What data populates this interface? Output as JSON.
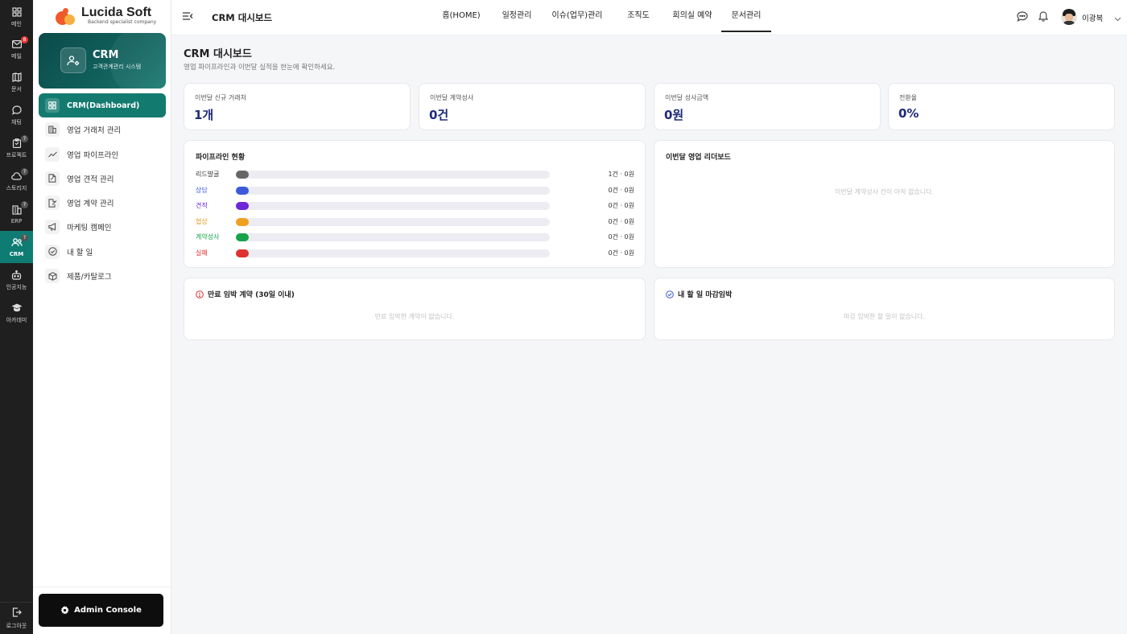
{
  "rail": {
    "items": [
      {
        "label": "메인",
        "icon": "grid-icon",
        "badge": ""
      },
      {
        "label": "메일",
        "icon": "mail-icon",
        "badge": "8"
      },
      {
        "label": "문서",
        "icon": "document-map-icon",
        "badge": ""
      },
      {
        "label": "채팅",
        "icon": "chat-icon",
        "badge": ""
      },
      {
        "label": "프로젝트",
        "icon": "clipboard-icon",
        "badge": "?"
      },
      {
        "label": "스토리지",
        "icon": "cloud-icon",
        "badge": "?"
      },
      {
        "label": "ERP",
        "icon": "building-icon",
        "badge": "?"
      },
      {
        "label": "CRM",
        "icon": "users-icon",
        "badge": "?",
        "active": true
      },
      {
        "label": "인공지능",
        "icon": "robot-icon",
        "badge": ""
      },
      {
        "label": "아카데미",
        "icon": "graduation-cap-icon",
        "badge": ""
      }
    ],
    "logout_label": "로그아웃"
  },
  "sidebar": {
    "logo_title": "Lucida Soft",
    "logo_sub": "Backend specialist company",
    "crm_card": {
      "title": "CRM",
      "subtitle": "고객관계관리 시스템"
    },
    "menu": [
      {
        "label": "CRM(Dashboard)",
        "icon": "dashboard-icon",
        "active": true
      },
      {
        "label": "영업 거래처 관리",
        "icon": "building-icon"
      },
      {
        "label": "영업 파이프라인",
        "icon": "trend-line-icon"
      },
      {
        "label": "영업 견적 관리",
        "icon": "file-edit-icon"
      },
      {
        "label": "영업 계약 관리",
        "icon": "file-sign-icon"
      },
      {
        "label": "마케팅 캠페인",
        "icon": "megaphone-icon"
      },
      {
        "label": "내 할 일",
        "icon": "check-circle-icon"
      },
      {
        "label": "제품/카탈로그",
        "icon": "box-icon"
      }
    ],
    "admin_label": "Admin Console"
  },
  "topbar": {
    "title": "CRM 대시보드",
    "nav": [
      "홈(HOME)",
      "일정관리",
      "이슈(업무)관리",
      "조직도",
      "회의실 예약",
      "문서관리"
    ],
    "active_nav": "문서관리",
    "user_name": "이광복"
  },
  "main": {
    "title": "CRM 대시보드",
    "subtitle": "영업 파이프라인과 이번달 실적을 한눈에 확인하세요.",
    "stats": [
      {
        "label": "이번달 신규 거래처",
        "value": "1개"
      },
      {
        "label": "이번달 계약성사",
        "value": "0건"
      },
      {
        "label": "이번달 성사금액",
        "value": "0원"
      },
      {
        "label": "전환율",
        "value": "0%"
      }
    ],
    "pipeline": {
      "title": "파이프라인 현황",
      "rows": [
        {
          "label": "리드발굴",
          "value": "1건 · 0원",
          "color": "#666666",
          "label_color": "#333333"
        },
        {
          "label": "상담",
          "value": "0건 · 0원",
          "color": "#3b5bdb",
          "label_color": "#3b5bdb"
        },
        {
          "label": "견적",
          "value": "0건 · 0원",
          "color": "#6d28d9",
          "label_color": "#6d28d9"
        },
        {
          "label": "협상",
          "value": "0건 · 0원",
          "color": "#f0a020",
          "label_color": "#e0a020"
        },
        {
          "label": "계약성사",
          "value": "0건 · 0원",
          "color": "#16a34a",
          "label_color": "#16a34a"
        },
        {
          "label": "실패",
          "value": "0건 · 0원",
          "color": "#e03131",
          "label_color": "#e03131"
        }
      ]
    },
    "leaderboard": {
      "title": "이번달 영업 리더보드",
      "empty": "이번달 계약성사 건이 아직 없습니다."
    },
    "expiring": {
      "title": "만료 임박 계약 (30일 이내)",
      "empty": "만료 임박한 계약이 없습니다."
    },
    "todo": {
      "title": "내 할 일 마감임박",
      "empty": "마감 임박한 할 일이 없습니다."
    }
  },
  "colors": {
    "accent": "#137a70",
    "value": "#1e2a78"
  }
}
